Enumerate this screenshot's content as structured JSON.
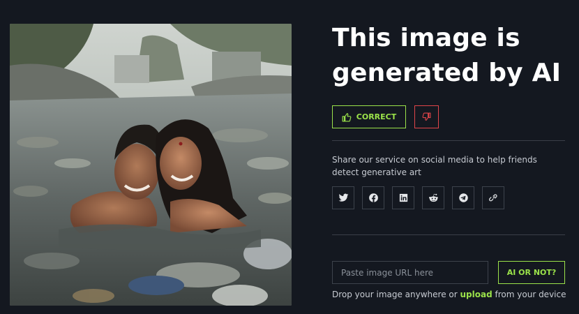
{
  "photo": {
    "alt": "Photo of a smiling couple in a polluted river"
  },
  "result": {
    "title_line1": "This image is",
    "title_line2": "generated by AI",
    "correct_label": "CORRECT",
    "correct_icon": "thumbs-up-icon",
    "wrong_icon": "thumbs-down-icon"
  },
  "share": {
    "text": "Share our service on social media to help friends detect generative art",
    "buttons": [
      "twitter-icon",
      "facebook-icon",
      "linkedin-icon",
      "reddit-icon",
      "telegram-icon",
      "link-icon"
    ]
  },
  "checker": {
    "url_placeholder": "Paste image URL here",
    "submit_label": "AI OR NOT?",
    "drop_prefix": "Drop your image anywhere or",
    "drop_link": "upload",
    "drop_suffix": "from your device"
  },
  "colors": {
    "background": "#141820",
    "accent_green": "#9be34a",
    "accent_red": "#e0454a",
    "border": "#3d434c"
  }
}
